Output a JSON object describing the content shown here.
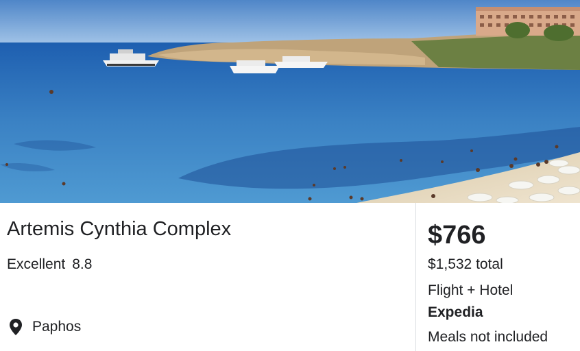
{
  "hotel": {
    "name": "Artemis Cynthia Complex",
    "rating_label": "Excellent",
    "rating_score": "8.8",
    "location": "Paphos",
    "location_icon": "map-pin-icon"
  },
  "pricing": {
    "price": "$766",
    "total": "$1,532 total",
    "package": "Flight + Hotel",
    "provider": "Expedia",
    "meals": "Meals not included"
  },
  "colors": {
    "text": "#202124",
    "divider": "#dadce0",
    "sea": "#2f6fb0",
    "sky": "#6fa3d8"
  }
}
